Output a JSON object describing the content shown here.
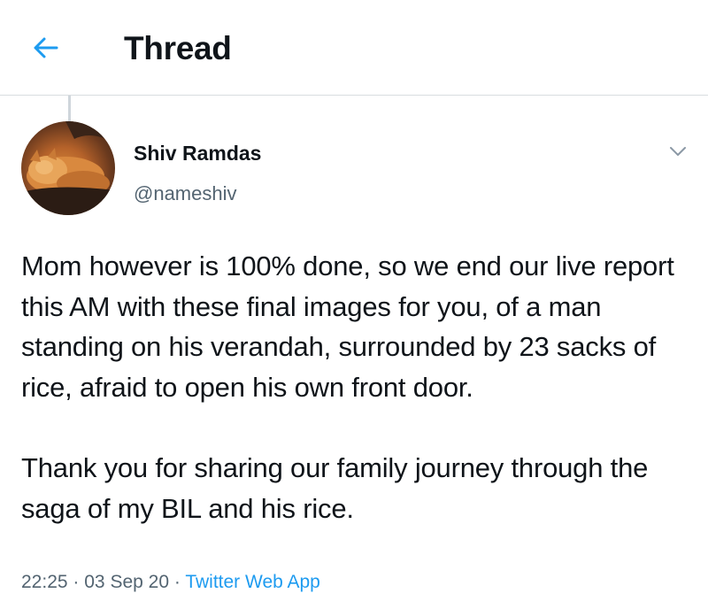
{
  "header": {
    "title": "Thread",
    "back_icon": "arrow-left-icon"
  },
  "tweet": {
    "author_name": "Shiv Ramdas",
    "author_handle": "@nameshiv",
    "avatar_description_icon": "avatar-cat-icon",
    "menu_icon": "chevron-down-icon",
    "paragraphs": [
      "Mom however is 100% done, so we end our live report this AM with these final images for you, of a man standing on his verandah, surrounded by 23 sacks of rice, afraid to open his own front door.",
      "Thank you for sharing our family journey through the saga of my BIL and his rice."
    ],
    "time": "22:25",
    "separator": "·",
    "date": "03 Sep 20",
    "source": "Twitter Web App"
  },
  "colors": {
    "accent": "#1d9bf0",
    "text_primary": "#0f1419",
    "text_secondary": "#536471",
    "divider": "#d9dde0"
  }
}
